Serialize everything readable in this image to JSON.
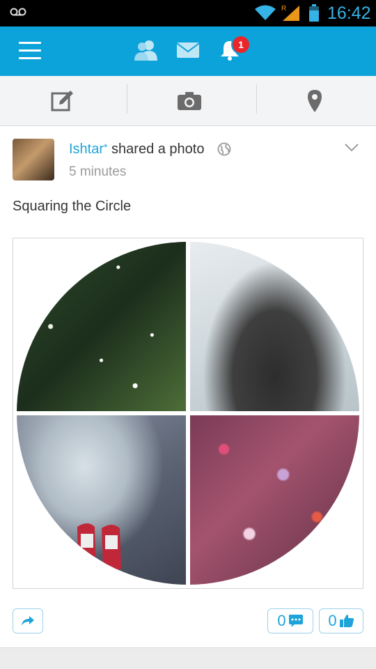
{
  "status_bar": {
    "time": "16:42",
    "roaming_indicator": "R",
    "icons": [
      "voicemail-icon",
      "wifi-icon",
      "signal-icon",
      "battery-icon"
    ]
  },
  "app_bar": {
    "icons": [
      "menu-icon",
      "friends-icon",
      "mail-icon",
      "notifications-icon"
    ],
    "notification_count": "1"
  },
  "action_bar": {
    "icons": [
      "compose-icon",
      "camera-icon",
      "location-pin-icon"
    ]
  },
  "post": {
    "author": "Ishtar",
    "author_marker": "*",
    "action": "shared a photo",
    "time_ago": "5 minutes",
    "text": "Squaring the Circle",
    "comments_count": "0",
    "likes_count": "0"
  },
  "colors": {
    "brand_blue": "#0ca3da",
    "link_blue": "#1ea4d9",
    "badge_red": "#e8262b",
    "status_blue": "#35b3e6"
  }
}
